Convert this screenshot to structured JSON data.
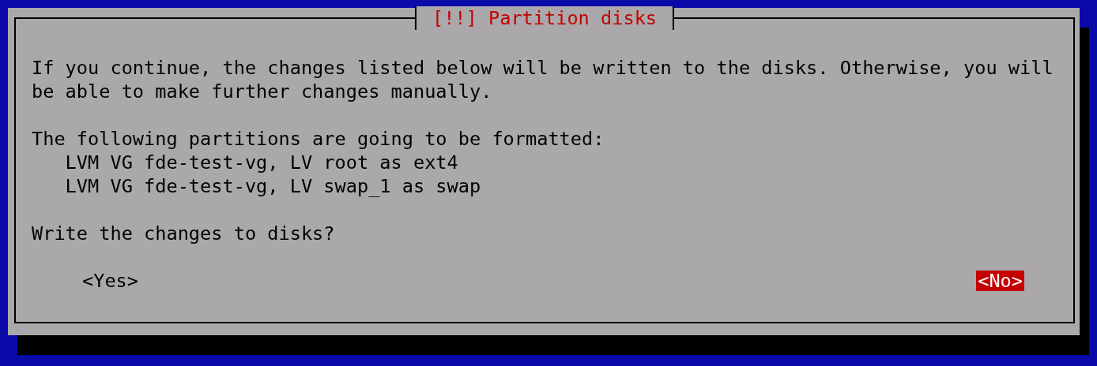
{
  "dialog": {
    "title": "[!!] Partition disks",
    "message": "If you continue, the changes listed below will be written to the disks. Otherwise, you will be able to make further changes manually.",
    "list_heading": "The following partitions are going to be formatted:",
    "partitions": [
      "LVM VG fde-test-vg, LV root as ext4",
      "LVM VG fde-test-vg, LV swap_1 as swap"
    ],
    "question": "Write the changes to disks?",
    "buttons": [
      {
        "label": "<Yes>",
        "selected": false
      },
      {
        "label": "<No>",
        "selected": true
      }
    ]
  }
}
